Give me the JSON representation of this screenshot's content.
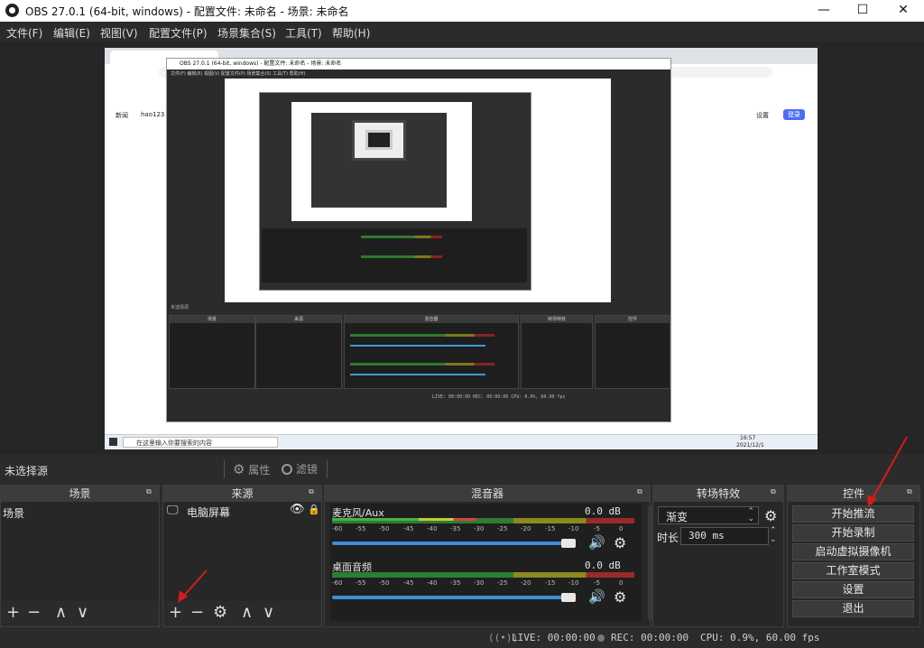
{
  "window": {
    "title": "OBS 27.0.1 (64-bit, windows) - 配置文件: 未命名 - 场景: 未命名",
    "minimize_icon": "—",
    "maximize_icon": "☐",
    "close_icon": "✕"
  },
  "menu": [
    "文件(F)",
    "编辑(E)",
    "视图(V)",
    "配置文件(P)",
    "场景集合(S)",
    "工具(T)",
    "帮助(H)"
  ],
  "preview": {
    "taskbar_search": "在这里输入你要搜索的内容",
    "clock_time": "16:57",
    "clock_date": "2021/12/1",
    "nested_title": "OBS 27.0.1 (64-bit, windows) - 配置文件: 未命名 - 场景: 未命名",
    "nested_menu": "文件(F)  编辑(E)  视图(V)  配置文件(P)  场景集合(S)  工具(T)  帮助(H)",
    "nested_status": "LIVE: 00:00:00   REC: 00:00:00   CPU: 0.9%, 60.00 fps",
    "browser_links": [
      "新闻",
      "hao123"
    ],
    "browser_login": "登录",
    "browser_settings": "设置"
  },
  "source_toolbar": {
    "no_source": "未选择源",
    "properties": "属性",
    "filters": "滤镜"
  },
  "scenes": {
    "title": "场景",
    "items": [
      "场景"
    ]
  },
  "sources": {
    "title": "来源",
    "items": [
      "电脑屏幕"
    ]
  },
  "mixer": {
    "title": "混音器",
    "channels": [
      {
        "name": "麦克风/Aux",
        "db": "0.0 dB",
        "volume": 0.97
      },
      {
        "name": "桌面音频",
        "db": "0.0 dB",
        "volume": 0.97
      }
    ],
    "ticks": [
      "-60",
      "-55",
      "-50",
      "-45",
      "-40",
      "-35",
      "-30",
      "-25",
      "-20",
      "-15",
      "-10",
      "-5",
      "0"
    ]
  },
  "transitions": {
    "title": "转场特效",
    "selected": "渐变",
    "duration_label": "时长",
    "duration_value": "300 ms"
  },
  "controls": {
    "title": "控件",
    "buttons": [
      "开始推流",
      "开始录制",
      "启动虚拟摄像机",
      "工作室模式",
      "设置",
      "退出"
    ]
  },
  "status": {
    "live": "LIVE: 00:00:00",
    "rec": "REC: 00:00:00",
    "cpu": "CPU: 0.9%, 60.00 fps"
  },
  "icons": {
    "add": "+",
    "remove": "−",
    "gear": "⚙",
    "up": "∧",
    "down": "∨",
    "eye": "👁",
    "lock": "🔒",
    "speaker": "🔊",
    "broadcast": "((•))",
    "monitor": "🖵",
    "undock": "⧉",
    "spin": "⌃⌄"
  },
  "colors": {
    "accent_slider": "#3c8ed6",
    "arrow": "#d51c1c",
    "meter_green": "#2e7d32",
    "meter_yellow": "#8a8a1f",
    "meter_red": "#9a2a2a"
  }
}
